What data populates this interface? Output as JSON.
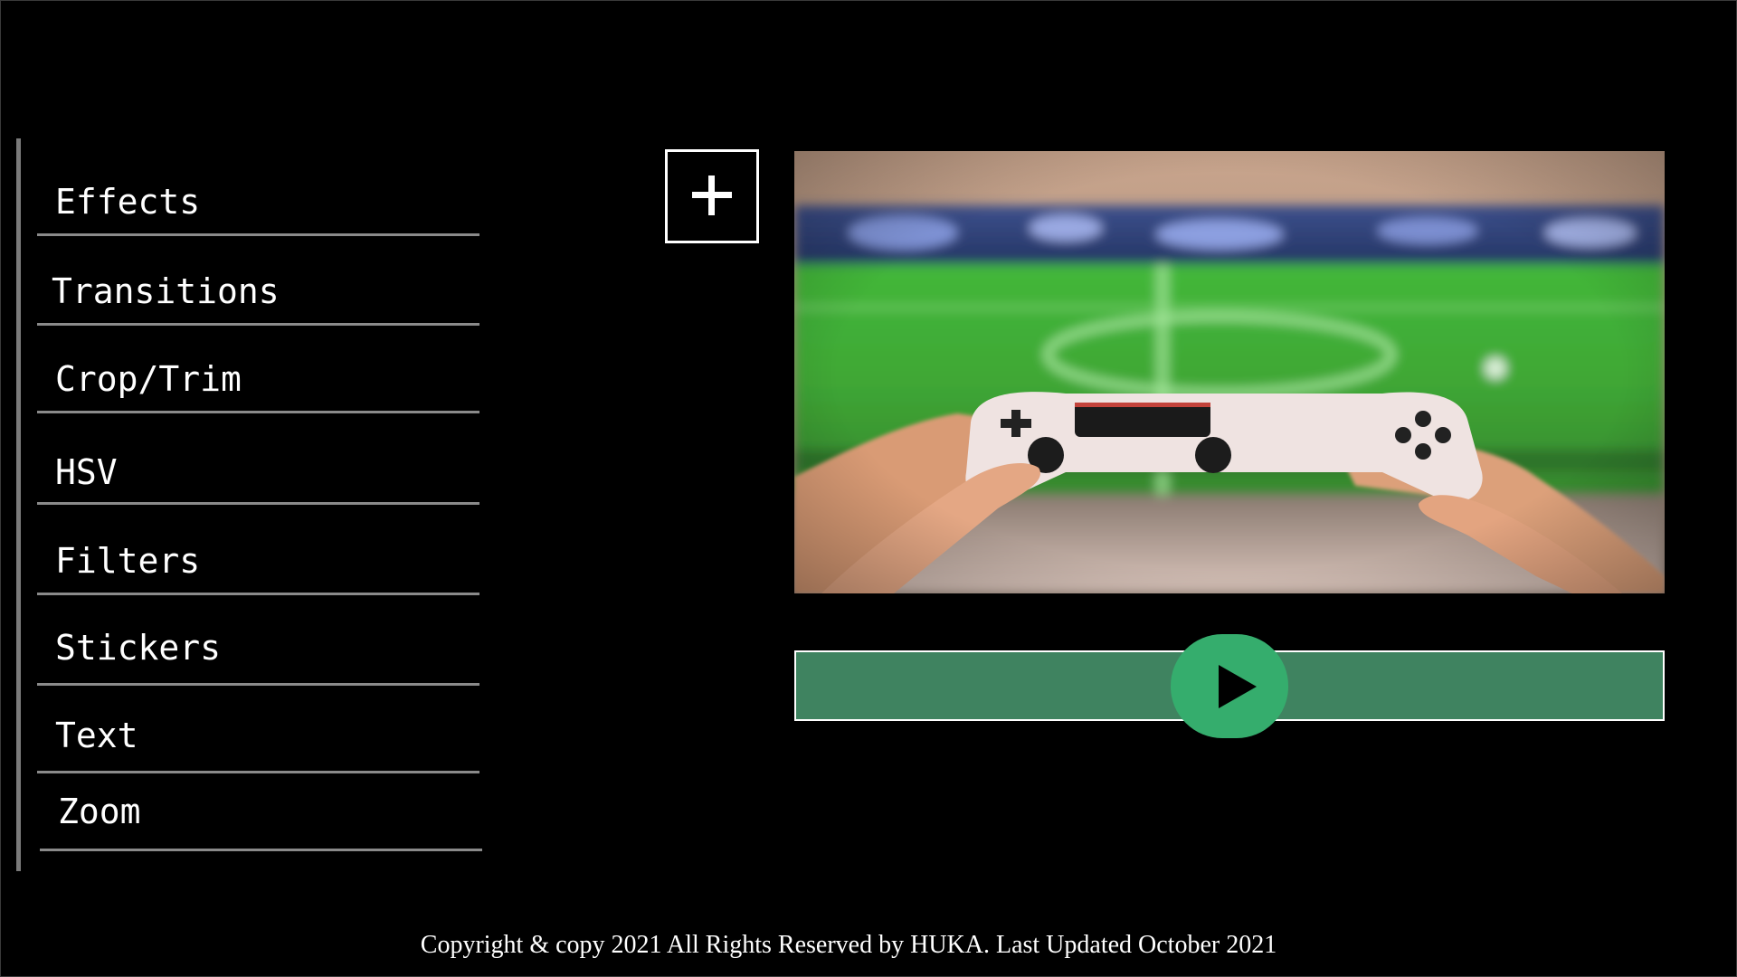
{
  "sidebar": {
    "items": [
      {
        "label": "Effects"
      },
      {
        "label": "Transitions"
      },
      {
        "label": "Crop/Trim"
      },
      {
        "label": "HSV"
      },
      {
        "label": "Filters"
      },
      {
        "label": "Stickers"
      },
      {
        "label": "Text"
      },
      {
        "label": "Zoom"
      }
    ]
  },
  "toolbar": {
    "add_icon": "plus-icon"
  },
  "player": {
    "preview_image": "hands holding game controller in front of TV showing soccer match",
    "play_icon": "play-icon",
    "progress": 0.5
  },
  "footer": {
    "text": "Copyright & copy 2021 All Rights Reserved by HUKA. Last Updated October 2021"
  },
  "colors": {
    "background": "#000000",
    "timeline": "#3f8360",
    "play_button": "#35ad6d",
    "text": "#ffffff"
  }
}
